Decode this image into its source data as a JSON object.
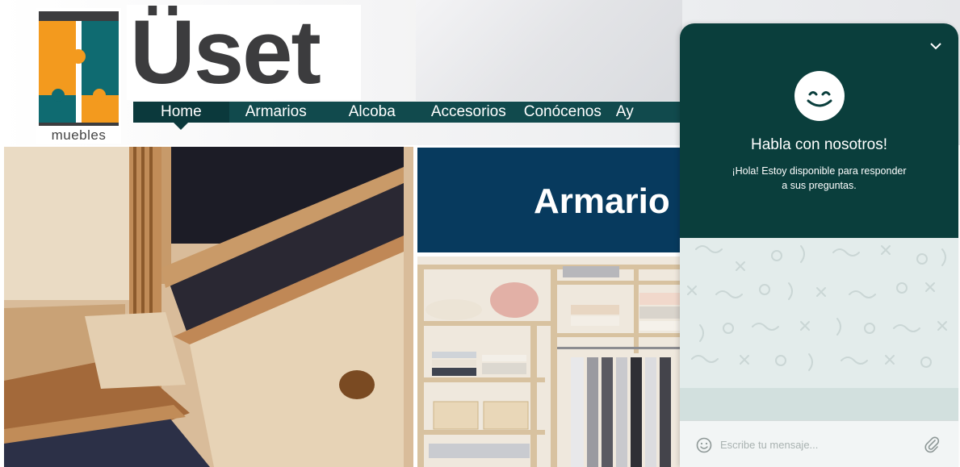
{
  "brand": {
    "name": "Üset",
    "tagline": "muebles"
  },
  "nav": {
    "items": [
      {
        "label": "Home",
        "active": true
      },
      {
        "label": "Armarios"
      },
      {
        "label": "Alcoba"
      },
      {
        "label": "Accesorios"
      },
      {
        "label": "Conócenos"
      },
      {
        "label": "Ay"
      }
    ]
  },
  "banner": {
    "title": "Armario"
  },
  "chat": {
    "title": "Habla con nosotros!",
    "subtitle": "¡Hola! Estoy disponible para responder a sus preguntas.",
    "input_placeholder": "Escribe tu mensaje...",
    "collapse_icon": "chevron-down-icon",
    "avatar_icon": "smiley-icon",
    "emoji_icon": "emoji-icon",
    "attach_icon": "paperclip-icon"
  },
  "colors": {
    "nav": "#114a4d",
    "chat_header": "#0a3e3c",
    "banner": "#073a5e",
    "logo_orange": "#f39a1e",
    "logo_teal": "#0f6b71"
  }
}
